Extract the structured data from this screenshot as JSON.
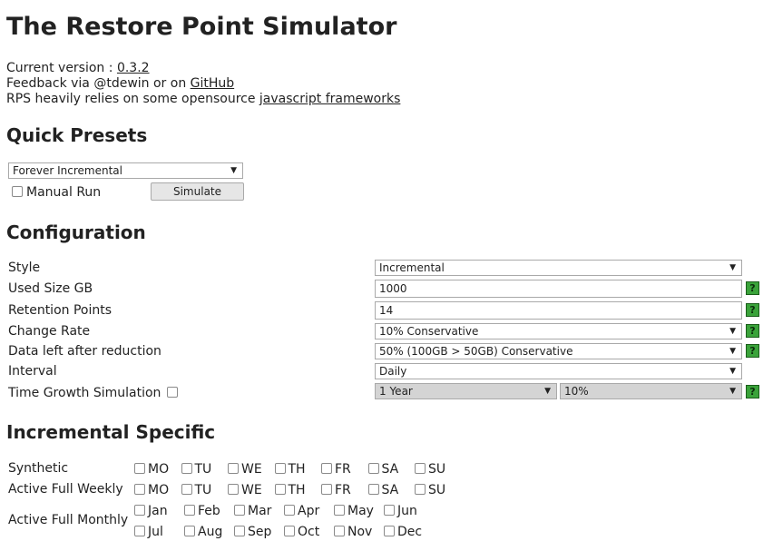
{
  "title": "The Restore Point Simulator",
  "info": {
    "version_prefix": "Current version : ",
    "version": "0.3.2",
    "feedback_prefix": "Feedback via @tdewin or on ",
    "feedback_link": "GitHub",
    "frameworks_prefix": "RPS heavily relies on some opensource ",
    "frameworks_link": "javascript frameworks"
  },
  "quick_presets": {
    "heading": "Quick Presets",
    "preset_selected": "Forever Incremental",
    "manual_run_label": "Manual Run",
    "simulate_button": "Simulate"
  },
  "configuration": {
    "heading": "Configuration",
    "style_label": "Style",
    "style_value": "Incremental",
    "used_size_label": "Used Size GB",
    "used_size_value": "1000",
    "retention_label": "Retention Points",
    "retention_value": "14",
    "change_rate_label": "Change Rate",
    "change_rate_value": "10% Conservative",
    "data_left_label": "Data left after reduction",
    "data_left_value": "50% (100GB > 50GB) Conservative",
    "interval_label": "Interval",
    "interval_value": "Daily",
    "time_growth_label": "Time Growth Simulation",
    "time_growth_period": "1 Year",
    "time_growth_rate": "10%",
    "help_glyph": "?"
  },
  "incremental_specific": {
    "heading": "Incremental Specific",
    "synthetic_label": "Synthetic",
    "active_full_weekly_label": "Active Full Weekly",
    "active_full_monthly_label": "Active Full Monthly",
    "days": [
      "MO",
      "TU",
      "WE",
      "TH",
      "FR",
      "SA",
      "SU"
    ],
    "months_row1": [
      "Jan",
      "Feb",
      "Mar",
      "Apr",
      "May",
      "Jun"
    ],
    "months_row2": [
      "Jul",
      "Aug",
      "Sep",
      "Oct",
      "Nov",
      "Dec"
    ]
  }
}
